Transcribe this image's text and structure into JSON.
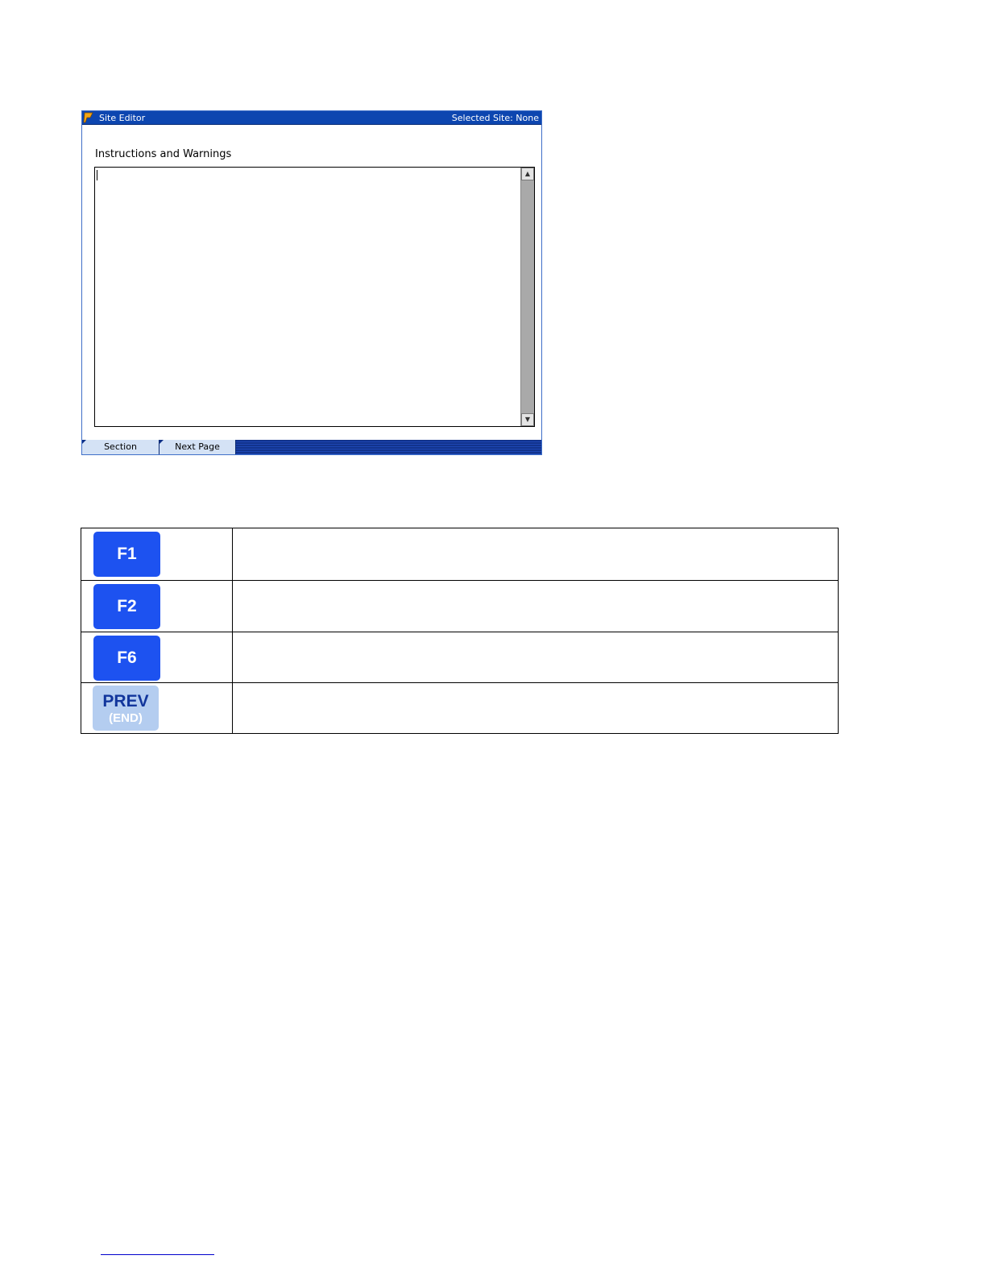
{
  "window": {
    "title": "Site Editor",
    "selected_site": "Selected Site: None",
    "section_label": "Instructions and Warnings",
    "softkeys": [
      "Section",
      "Next Page"
    ]
  },
  "keys": [
    {
      "label": "F1",
      "description": ""
    },
    {
      "label": "F2",
      "description": ""
    },
    {
      "label": "F6",
      "description": ""
    },
    {
      "label": "PREV",
      "sublabel": "(END)",
      "description": ""
    }
  ],
  "colors": {
    "titlebar": "#0d46b0",
    "fkey": "#1d52f0",
    "prevkey": "#b4cdf0"
  }
}
